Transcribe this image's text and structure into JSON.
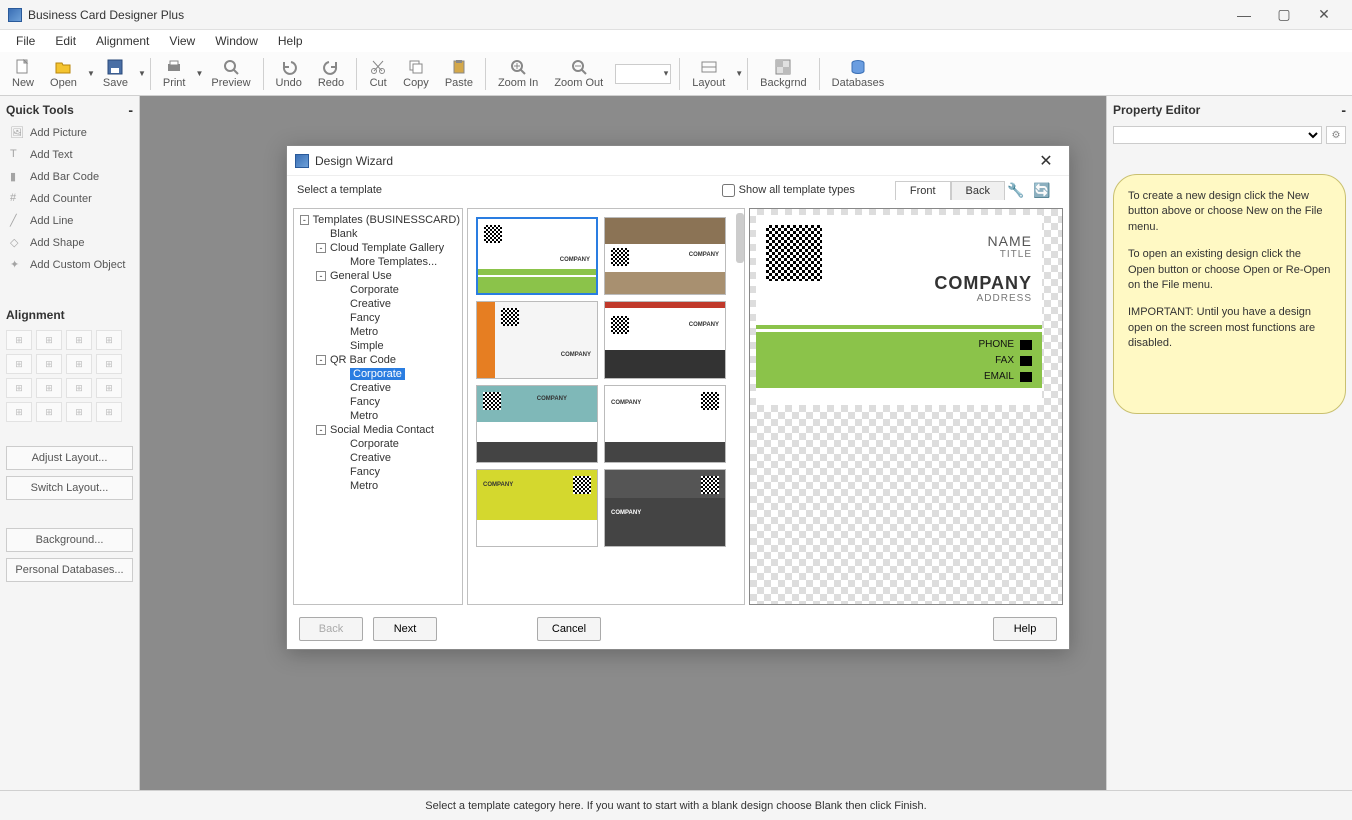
{
  "app": {
    "title": "Business Card Designer Plus"
  },
  "menubar": [
    "File",
    "Edit",
    "Alignment",
    "View",
    "Window",
    "Help"
  ],
  "toolbar": [
    {
      "id": "new",
      "label": "New"
    },
    {
      "id": "open",
      "label": "Open",
      "drop": true
    },
    {
      "id": "save",
      "label": "Save",
      "drop": true
    },
    {
      "sep": true
    },
    {
      "id": "print",
      "label": "Print",
      "drop": true
    },
    {
      "id": "preview",
      "label": "Preview"
    },
    {
      "sep": true
    },
    {
      "id": "undo",
      "label": "Undo"
    },
    {
      "id": "redo",
      "label": "Redo"
    },
    {
      "sep": true
    },
    {
      "id": "cut",
      "label": "Cut"
    },
    {
      "id": "copy",
      "label": "Copy"
    },
    {
      "id": "paste",
      "label": "Paste"
    },
    {
      "sep": true
    },
    {
      "id": "zoomin",
      "label": "Zoom In"
    },
    {
      "id": "zoomout",
      "label": "Zoom Out"
    },
    {
      "combo": true
    },
    {
      "sep": true
    },
    {
      "id": "layout",
      "label": "Layout",
      "drop": true
    },
    {
      "sep": true
    },
    {
      "id": "backgrnd",
      "label": "Backgrnd"
    },
    {
      "sep": true
    },
    {
      "id": "databases",
      "label": "Databases"
    }
  ],
  "quicktools": {
    "title": "Quick Tools",
    "items": [
      "Add Picture",
      "Add Text",
      "Add Bar Code",
      "Add Counter",
      "Add Line",
      "Add Shape",
      "Add Custom Object"
    ]
  },
  "alignment": {
    "title": "Alignment"
  },
  "leftbuttons": {
    "adjust": "Adjust Layout...",
    "switch": "Switch Layout...",
    "background": "Background...",
    "personal": "Personal Databases..."
  },
  "propeditor": {
    "title": "Property Editor"
  },
  "hints": [
    "To create a new design click the New button above or choose New on the File menu.",
    "To open an existing design click the Open button or choose Open or Re-Open on the File menu.",
    "IMPORTANT: Until you have a design open on the screen most functions are disabled."
  ],
  "statusbar": "Select a template category here.  If you want to start with a blank design choose Blank then click Finish.",
  "dialog": {
    "title": "Design Wizard",
    "subtitle": "Select a template",
    "showall": "Show all template types",
    "tab_front": "Front",
    "tab_back": "Back",
    "tree": [
      {
        "l": 1,
        "exp": "-",
        "label": "Templates (BUSINESSCARD)"
      },
      {
        "l": 2,
        "label": "Blank"
      },
      {
        "l": 2,
        "exp": "-",
        "label": "Cloud Template Gallery"
      },
      {
        "l": 3,
        "label": "More Templates..."
      },
      {
        "l": 2,
        "exp": "-",
        "label": "General Use"
      },
      {
        "l": 3,
        "label": "Corporate"
      },
      {
        "l": 3,
        "label": "Creative"
      },
      {
        "l": 3,
        "label": "Fancy"
      },
      {
        "l": 3,
        "label": "Metro"
      },
      {
        "l": 3,
        "label": "Simple"
      },
      {
        "l": 2,
        "exp": "-",
        "label": "QR Bar Code"
      },
      {
        "l": 3,
        "label": "Corporate",
        "sel": true
      },
      {
        "l": 3,
        "label": "Creative"
      },
      {
        "l": 3,
        "label": "Fancy"
      },
      {
        "l": 3,
        "label": "Metro"
      },
      {
        "l": 2,
        "exp": "-",
        "label": "Social Media Contact"
      },
      {
        "l": 3,
        "label": "Corporate"
      },
      {
        "l": 3,
        "label": "Creative"
      },
      {
        "l": 3,
        "label": "Fancy"
      },
      {
        "l": 3,
        "label": "Metro"
      }
    ],
    "buttons": {
      "back": "Back",
      "next": "Next",
      "cancel": "Cancel",
      "help": "Help"
    }
  },
  "preview_card": {
    "name": "NAME",
    "title": "TITLE",
    "company": "COMPANY",
    "address": "ADDRESS",
    "phone": "PHONE",
    "fax": "FAX",
    "email": "EMAIL"
  },
  "thumb_company": "COMPANY"
}
